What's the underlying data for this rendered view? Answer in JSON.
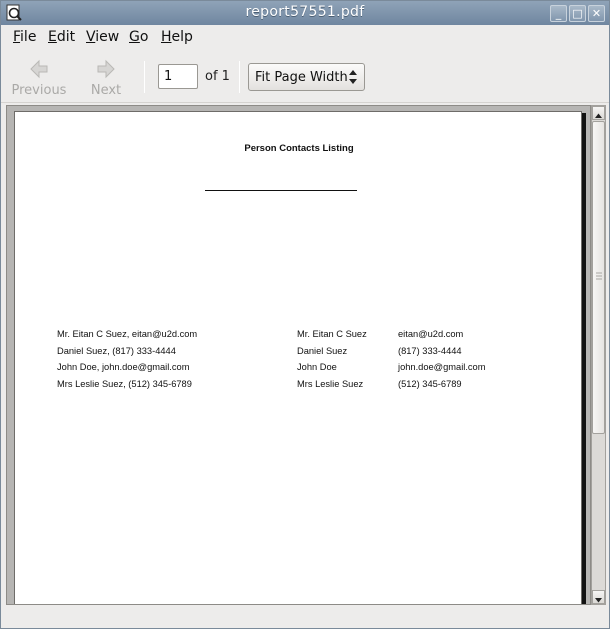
{
  "window": {
    "title": "report57551.pdf",
    "icon": "document-viewer-icon",
    "controls": {
      "minimize": "_",
      "maximize": "□",
      "close": "✕"
    }
  },
  "menubar": {
    "items": [
      {
        "label": "File",
        "mnemonic": "F",
        "rest": "ile"
      },
      {
        "label": "Edit",
        "mnemonic": "E",
        "rest": "dit"
      },
      {
        "label": "View",
        "mnemonic": "V",
        "rest": "iew"
      },
      {
        "label": "Go",
        "mnemonic": "G",
        "rest": "o"
      },
      {
        "label": "Help",
        "mnemonic": "H",
        "rest": "elp"
      }
    ]
  },
  "toolbar": {
    "previous_label": "Previous",
    "next_label": "Next",
    "page_value": "1",
    "page_of_label": "of 1",
    "zoom_value": "Fit Page Width"
  },
  "document": {
    "title": "Person Contacts Listing",
    "left_list": [
      "Mr. Eitan C Suez, eitan@u2d.com",
      "Daniel Suez, (817) 333-4444",
      "John Doe, john.doe@gmail.com",
      "Mrs Leslie Suez, (512) 345-6789"
    ],
    "right_table": [
      {
        "name": "Mr. Eitan C Suez",
        "contact": "eitan@u2d.com"
      },
      {
        "name": "Daniel Suez",
        "contact": "(817) 333-4444"
      },
      {
        "name": "John Doe",
        "contact": "john.doe@gmail.com"
      },
      {
        "name": "Mrs Leslie Suez",
        "contact": "(512) 345-6789"
      }
    ]
  },
  "colors": {
    "titlebar": "#7d92a8",
    "window_bg": "#edeceb",
    "viewport_bg": "#b6b5b3"
  }
}
